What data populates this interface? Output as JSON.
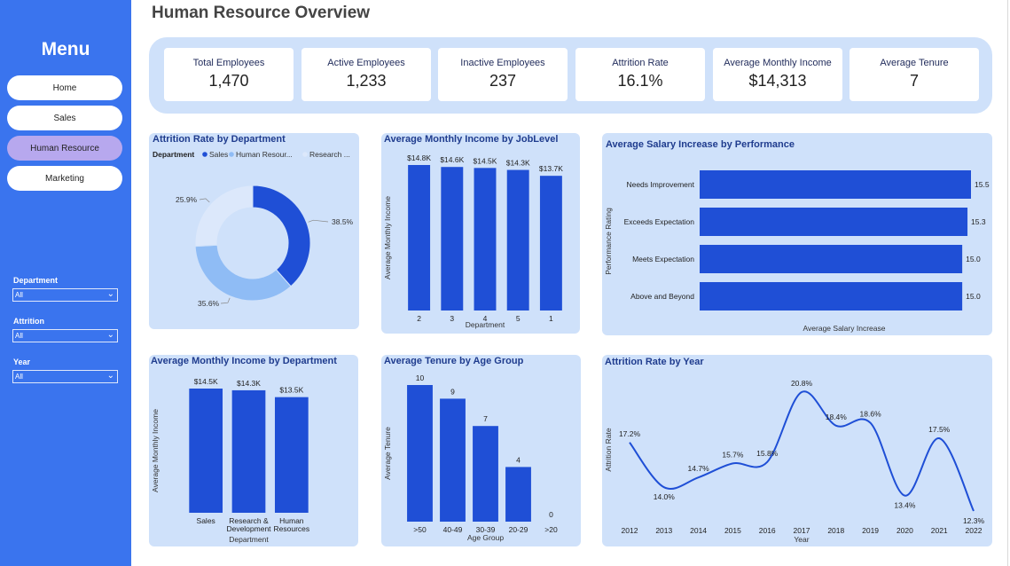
{
  "sidebar": {
    "title": "Menu",
    "nav": [
      {
        "label": "Home"
      },
      {
        "label": "Sales"
      },
      {
        "label": "Human Resource"
      },
      {
        "label": "Marketing"
      }
    ],
    "filters": [
      {
        "label": "Department",
        "value": "All"
      },
      {
        "label": "Attrition",
        "value": "All"
      },
      {
        "label": "Year",
        "value": "All"
      }
    ]
  },
  "page_title": "Human Resource Overview",
  "kpis": [
    {
      "label": "Total Employees",
      "value": "1,470"
    },
    {
      "label": "Active Employees",
      "value": "1,233"
    },
    {
      "label": "Inactive Employees",
      "value": "237"
    },
    {
      "label": "Attrition Rate",
      "value": "16.1%"
    },
    {
      "label": "Average Monthly Income",
      "value": "$14,313"
    },
    {
      "label": "Average Tenure",
      "value": "7"
    }
  ],
  "colors": {
    "accent": "#1f4fd6",
    "light": "#8fbcf5",
    "lighter": "#dce8fb",
    "panel": "#cfe1fa",
    "sidebar": "#3a74ee"
  },
  "chart_data": [
    {
      "id": "donut",
      "type": "pie",
      "title": "Attrition Rate by Department",
      "legend_title": "Department",
      "legend": [
        "Sales",
        "Human Resour...",
        "Research ..."
      ],
      "slices": [
        {
          "name": "Sales",
          "value": 38.5,
          "label": "38.5%",
          "color": "#1f4fd6"
        },
        {
          "name": "Human Resources",
          "value": 35.6,
          "label": "35.6%",
          "color": "#8fbcf5"
        },
        {
          "name": "Research & Development",
          "value": 25.9,
          "label": "25.9%",
          "color": "#dce8fb"
        }
      ]
    },
    {
      "id": "joblevel",
      "type": "bar",
      "title": "Average Monthly Income by JobLevel",
      "categories": [
        "2",
        "3",
        "4",
        "5",
        "1"
      ],
      "values": [
        14.8,
        14.6,
        14.5,
        14.3,
        13.7
      ],
      "labels": [
        "$14.8K",
        "$14.6K",
        "$14.5K",
        "$14.3K",
        "$13.7K"
      ],
      "xlabel": "Department",
      "ylabel": "Average Monthly Income"
    },
    {
      "id": "salary",
      "type": "bar",
      "orientation": "horizontal",
      "title": "Average Salary Increase by Performance",
      "categories": [
        "Needs Improvement",
        "Exceeds Expectation",
        "Meets Expectation",
        "Above and Beyond"
      ],
      "values": [
        15.5,
        15.3,
        15.0,
        15.0
      ],
      "labels": [
        "15.5",
        "15.3",
        "15.0",
        "15.0"
      ],
      "xlabel": "Average Salary Increase",
      "ylabel": "Performance Rating"
    },
    {
      "id": "income_dept",
      "type": "bar",
      "title": "Average Monthly Income by Department",
      "categories": [
        [
          "Sales"
        ],
        [
          "Research &",
          "Development"
        ],
        [
          "Human",
          "Resources"
        ]
      ],
      "values": [
        14.5,
        14.3,
        13.5
      ],
      "labels": [
        "$14.5K",
        "$14.3K",
        "$13.5K"
      ],
      "xlabel": "Department",
      "ylabel": "Average Monthly Income"
    },
    {
      "id": "tenure",
      "type": "bar",
      "title": "Average Tenure by Age Group",
      "categories": [
        ">50",
        "40-49",
        "30-39",
        "20-29",
        ">20"
      ],
      "values": [
        10,
        9,
        7,
        4,
        0
      ],
      "labels": [
        "10",
        "9",
        "7",
        "4",
        "0"
      ],
      "xlabel": "Age Group",
      "ylabel": "Average Tenure"
    },
    {
      "id": "attr_year",
      "type": "line",
      "title": "Attrition Rate by Year",
      "x": [
        "2012",
        "2013",
        "2014",
        "2015",
        "2016",
        "2017",
        "2018",
        "2019",
        "2020",
        "2021",
        "2022"
      ],
      "values": [
        17.2,
        14.0,
        14.7,
        15.7,
        15.8,
        20.8,
        18.4,
        18.6,
        13.4,
        17.5,
        12.3
      ],
      "labels": [
        "17.2%",
        "14.0%",
        "14.7%",
        "15.7%",
        "15.8%",
        "20.8%",
        "18.4%",
        "18.6%",
        "13.4%",
        "17.5%",
        "12.3%"
      ],
      "xlabel": "Year",
      "ylabel": "Attrition Rate"
    }
  ]
}
